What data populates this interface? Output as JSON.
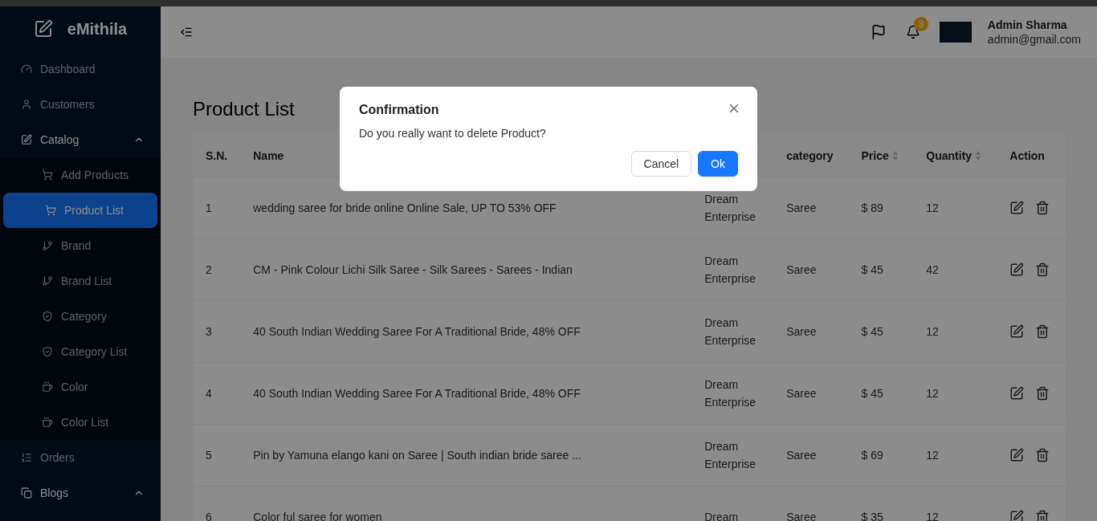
{
  "brand": {
    "name": "eMithila"
  },
  "sidebar": {
    "items": [
      {
        "label": "Dashboard",
        "selected": false
      },
      {
        "label": "Customers",
        "selected": false
      },
      {
        "label": "Catalog",
        "selected": false,
        "expanded": true,
        "children": [
          {
            "label": "Add Products",
            "selected": false
          },
          {
            "label": "Product List",
            "selected": true
          },
          {
            "label": "Brand",
            "selected": false
          },
          {
            "label": "Brand List",
            "selected": false
          },
          {
            "label": "Category",
            "selected": false
          },
          {
            "label": "Category List",
            "selected": false
          },
          {
            "label": "Color",
            "selected": false
          },
          {
            "label": "Color List",
            "selected": false
          }
        ]
      },
      {
        "label": "Orders",
        "selected": false
      },
      {
        "label": "Blogs",
        "selected": false,
        "expanded": true
      }
    ]
  },
  "header": {
    "notification_count": "3",
    "user_name": "Admin Sharma",
    "user_email": "admin@gmail.com"
  },
  "page": {
    "title": "Product List"
  },
  "table": {
    "columns": [
      {
        "label": "S.N.",
        "sortable": false
      },
      {
        "label": "Name",
        "sortable": false
      },
      {
        "sortable": false
      },
      {
        "label": "category",
        "sortable": false
      },
      {
        "label": "Price",
        "sortable": true
      },
      {
        "label": "Quantity",
        "sortable": true
      },
      {
        "label": "Action",
        "sortable": false
      }
    ],
    "rows": [
      {
        "sn": "1",
        "name": "wedding saree for bride online Online Sale, UP TO 53% OFF",
        "column_3": "Dream Enterprise",
        "category": "Saree",
        "price": "$ 89",
        "quantity": "12"
      },
      {
        "sn": "2",
        "name": "CM - Pink Colour Lichi Silk Saree - Silk Sarees - Sarees - Indian",
        "column_3": "Dream Enterprise",
        "category": "Saree",
        "price": "$ 45",
        "quantity": "42"
      },
      {
        "sn": "3",
        "name": "40 South Indian Wedding Saree For A Traditional Bride, 48% OFF",
        "column_3": "Dream Enterprise",
        "category": "Saree",
        "price": "$ 45",
        "quantity": "12"
      },
      {
        "sn": "4",
        "name": "40 South Indian Wedding Saree For A Traditional Bride, 48% OFF",
        "column_3": "Dream Enterprise",
        "category": "Saree",
        "price": "$ 45",
        "quantity": "12"
      },
      {
        "sn": "5",
        "name": "Pin by Yamuna elango kani on Saree | South indian bride saree ...",
        "column_3": "Dream Enterprise",
        "category": "Saree",
        "price": "$ 69",
        "quantity": "12"
      },
      {
        "sn": "6",
        "name": "Color ful saree for women",
        "column_3": "Dream",
        "category": "Saree",
        "price": "$ 35",
        "quantity": "12"
      }
    ]
  },
  "dialog": {
    "title": "Confirmation",
    "message": "Do you really want to delete Product?",
    "buttons": [
      {
        "label": "Cancel",
        "kind": "default"
      },
      {
        "label": "Ok",
        "kind": "primary"
      }
    ]
  }
}
